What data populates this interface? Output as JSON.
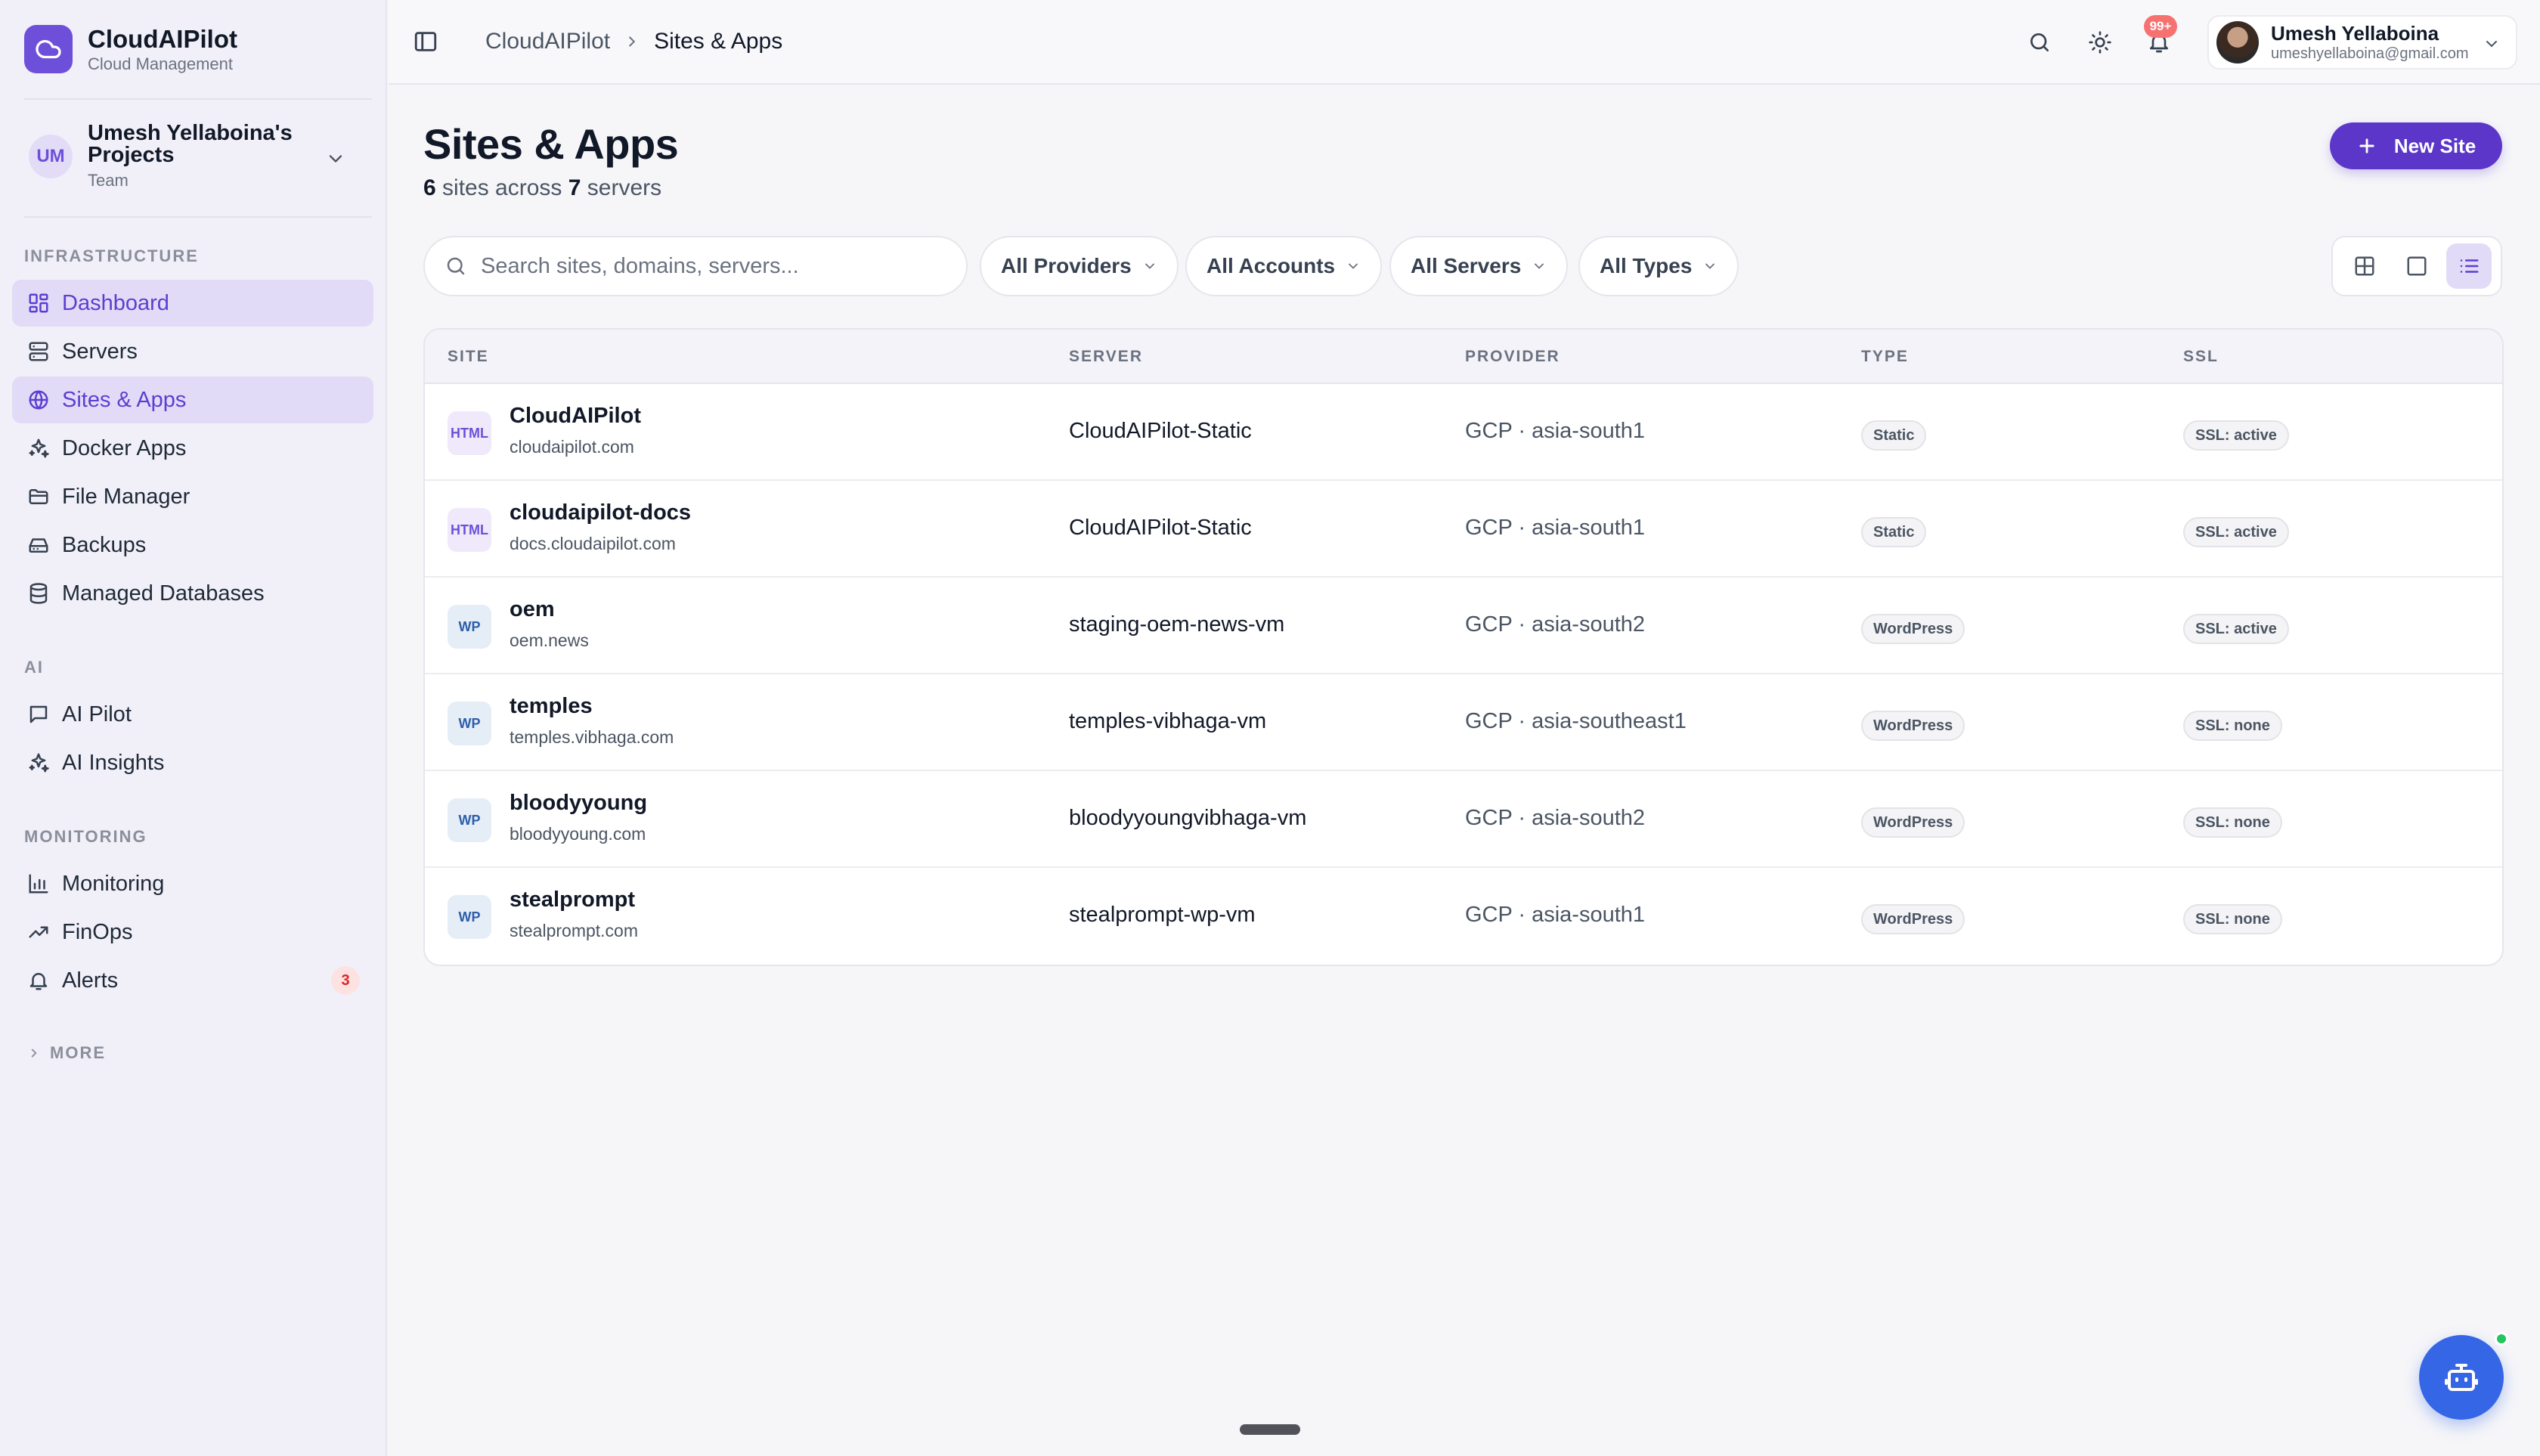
{
  "brand": {
    "name": "CloudAIPilot",
    "subtitle": "Cloud Management"
  },
  "project": {
    "initials": "UM",
    "name": "Umesh Yellaboina's Projects",
    "role": "Team"
  },
  "sidebar": {
    "sections": [
      {
        "label": "INFRASTRUCTURE",
        "items": [
          {
            "label": "Dashboard",
            "icon": "grid-icon"
          },
          {
            "label": "Servers",
            "icon": "server-icon"
          },
          {
            "label": "Sites & Apps",
            "icon": "globe-icon"
          },
          {
            "label": "Docker Apps",
            "icon": "sparkle-icon"
          },
          {
            "label": "File Manager",
            "icon": "folder-icon"
          },
          {
            "label": "Backups",
            "icon": "drive-icon"
          },
          {
            "label": "Managed Databases",
            "icon": "database-icon"
          }
        ]
      },
      {
        "label": "AI",
        "items": [
          {
            "label": "AI Pilot",
            "icon": "chat-icon"
          },
          {
            "label": "AI Insights",
            "icon": "sparkle-icon"
          }
        ]
      },
      {
        "label": "MONITORING",
        "items": [
          {
            "label": "Monitoring",
            "icon": "bar-chart-icon"
          },
          {
            "label": "FinOps",
            "icon": "trend-icon"
          },
          {
            "label": "Alerts",
            "icon": "bell-icon",
            "badge": "3"
          }
        ]
      }
    ],
    "more_label": "MORE"
  },
  "topbar": {
    "breadcrumb_root": "CloudAIPilot",
    "breadcrumb_current": "Sites & Apps",
    "notifications_badge": "99+",
    "user": {
      "name": "Umesh Yellaboina",
      "email": "umeshyellaboina@gmail.com"
    }
  },
  "page": {
    "title": "Sites & Apps",
    "sites_count": "6",
    "sites_text": "sites across",
    "servers_count": "7",
    "servers_text": "servers",
    "new_site_label": "New Site"
  },
  "filters": {
    "search_placeholder": "Search sites, domains, servers...",
    "providers": "All Providers",
    "accounts": "All Accounts",
    "servers": "All Servers",
    "types": "All Types"
  },
  "table": {
    "headers": {
      "site": "SITE",
      "server": "SERVER",
      "provider": "PROVIDER",
      "type": "TYPE",
      "ssl": "SSL"
    },
    "rows": [
      {
        "badge": "HTML",
        "kind": "html",
        "name": "CloudAIPilot",
        "domain": "cloudaipilot.com",
        "server": "CloudAIPilot-Static",
        "provider": "GCP · asia-south1",
        "type": "Static",
        "ssl": "SSL: active"
      },
      {
        "badge": "HTML",
        "kind": "html",
        "name": "cloudaipilot-docs",
        "domain": "docs.cloudaipilot.com",
        "server": "CloudAIPilot-Static",
        "provider": "GCP · asia-south1",
        "type": "Static",
        "ssl": "SSL: active"
      },
      {
        "badge": "WP",
        "kind": "wp",
        "name": "oem",
        "domain": "oem.news",
        "server": "staging-oem-news-vm",
        "provider": "GCP · asia-south2",
        "type": "WordPress",
        "ssl": "SSL: active"
      },
      {
        "badge": "WP",
        "kind": "wp",
        "name": "temples",
        "domain": "temples.vibhaga.com",
        "server": "temples-vibhaga-vm",
        "provider": "GCP · asia-southeast1",
        "type": "WordPress",
        "ssl": "SSL: none"
      },
      {
        "badge": "WP",
        "kind": "wp",
        "name": "bloodyyoung",
        "domain": "bloodyyoung.com",
        "server": "bloodyyoungvibhaga-vm",
        "provider": "GCP · asia-south2",
        "type": "WordPress",
        "ssl": "SSL: none"
      },
      {
        "badge": "WP",
        "kind": "wp",
        "name": "stealprompt",
        "domain": "stealprompt.com",
        "server": "stealprompt-wp-vm",
        "provider": "GCP · asia-south1",
        "type": "WordPress",
        "ssl": "SSL: none"
      }
    ]
  },
  "colors": {
    "accent": "#5b36c9",
    "active_bg": "#e2dbf7",
    "bot": "#3566e6",
    "online": "#22c55e",
    "alert": "#dc2626"
  }
}
